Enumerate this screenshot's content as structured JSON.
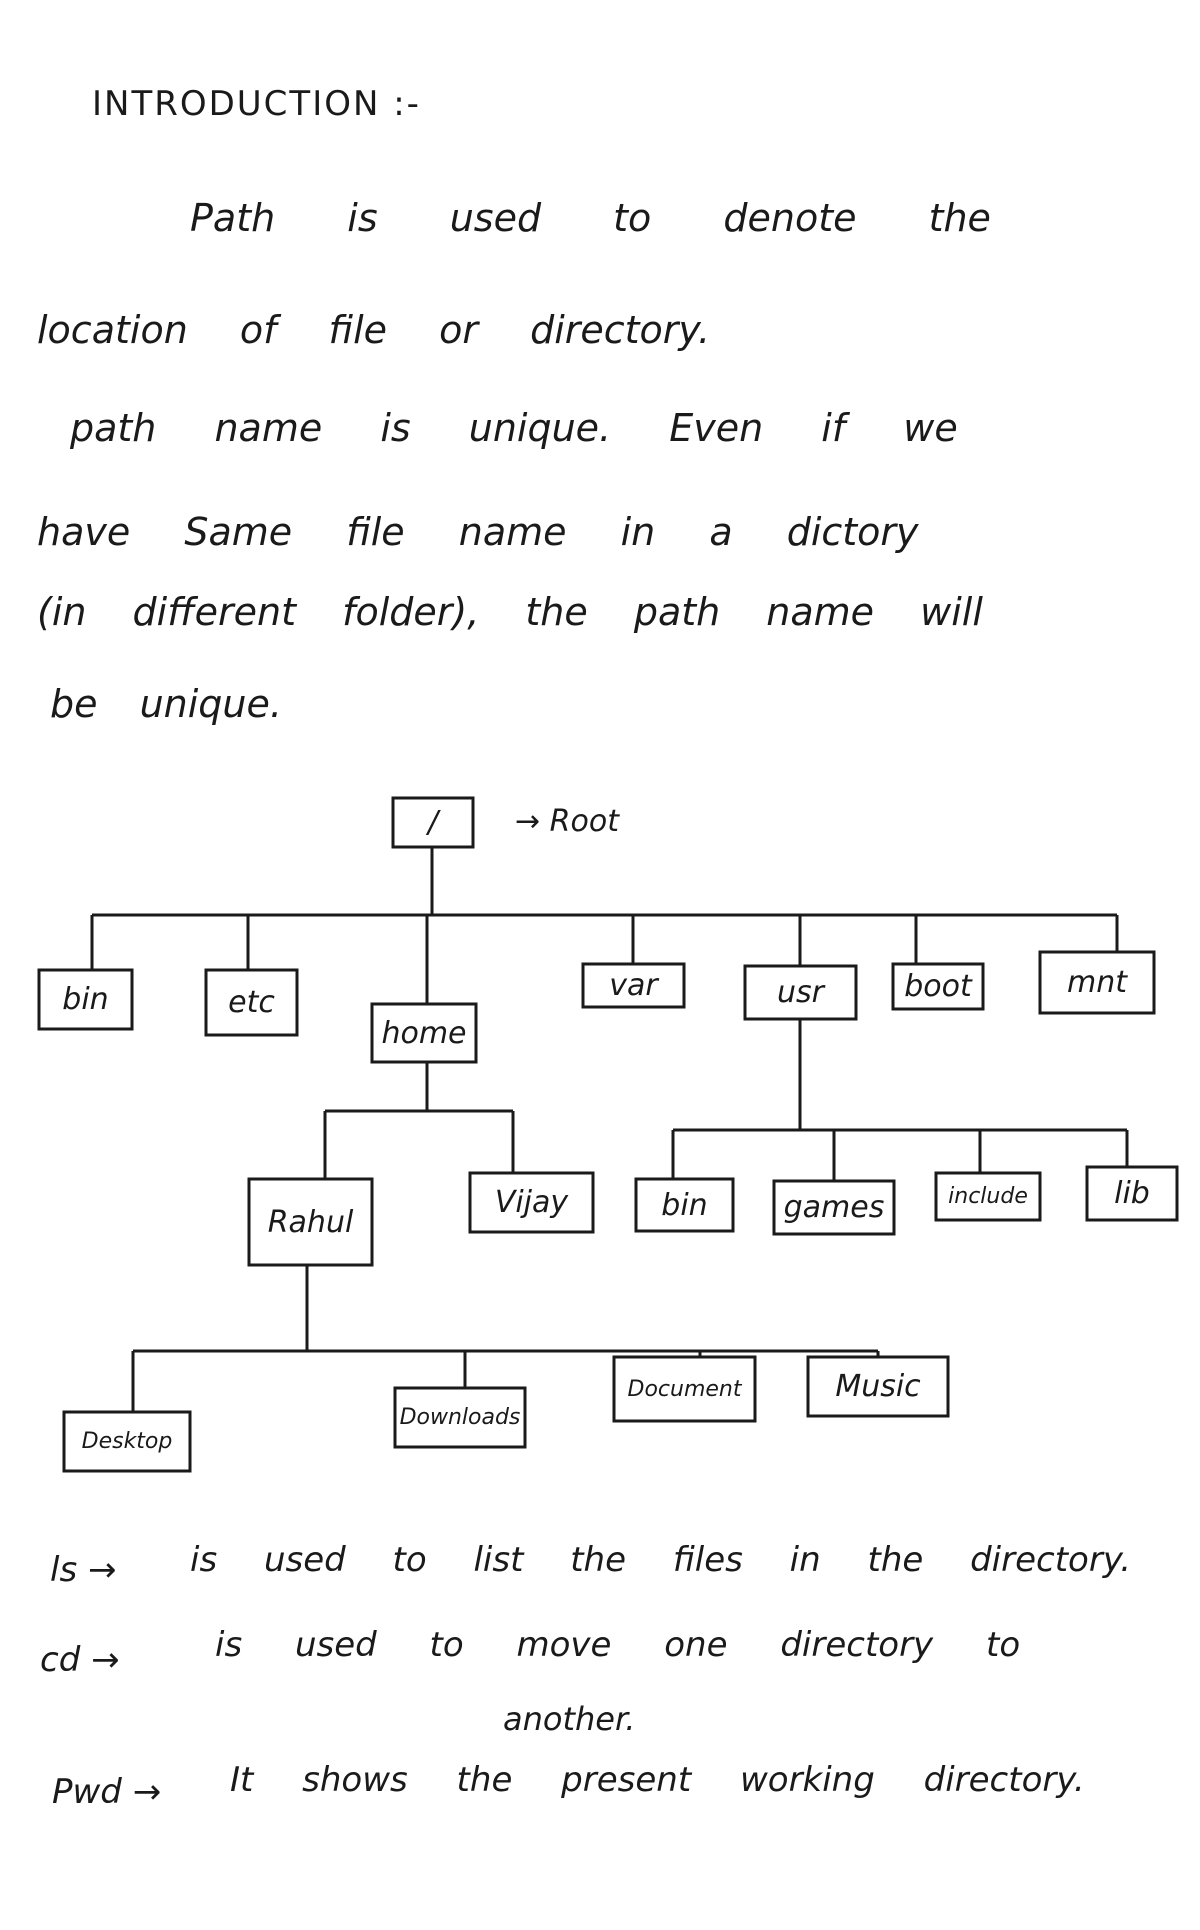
{
  "heading": "INTRODUCTION :-",
  "paragraph": [
    "Path is used to denote the",
    "location of file or directory.",
    "path name is unique. Even if we",
    "have Same file name in a dictory",
    "(in different folder), the path name will",
    "be unique."
  ],
  "tree": {
    "root": {
      "label": "/",
      "annotation": "→ Root"
    },
    "level1": [
      "bin",
      "etc",
      "home",
      "var",
      "usr",
      "boot",
      "mnt"
    ],
    "home_children": [
      "Rahul",
      "Vijay"
    ],
    "usr_children": [
      "bin",
      "games",
      "include",
      "lib"
    ],
    "rahul_children": [
      "Desktop",
      "Downloads",
      "Document",
      "Music"
    ]
  },
  "commands": [
    {
      "cmd": "ls →",
      "desc": "is used to list the files in the directory."
    },
    {
      "cmd": "cd →",
      "desc": "is used to move one directory to",
      "desc2": "another."
    },
    {
      "cmd": "Pwd →",
      "desc": "It shows the present working directory."
    }
  ],
  "ink_color": "#1a1a1a"
}
